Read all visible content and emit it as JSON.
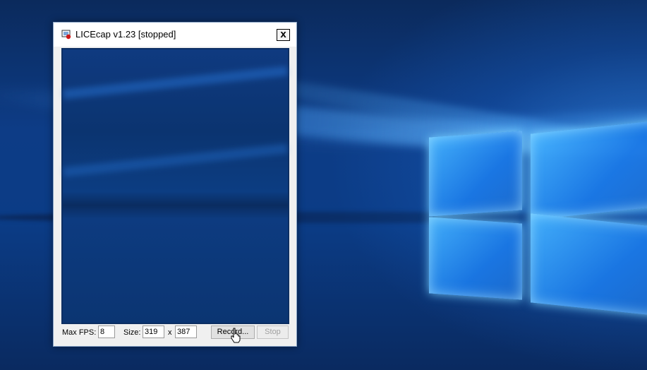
{
  "window": {
    "title": "LICEcap v1.23 [stopped]",
    "close_label": "x"
  },
  "controls": {
    "max_fps_label": "Max FPS:",
    "max_fps_value": "8",
    "size_label": "Size:",
    "width_value": "319",
    "x_label": "x",
    "height_value": "387",
    "record_label": "Record...",
    "stop_label": "Stop"
  },
  "icons": {
    "app": "licecap-app-icon",
    "cursor": "hand-pointer-cursor"
  },
  "colors": {
    "desktop_blue": "#0d3c86",
    "window_bg": "#f0f0f0",
    "disabled_text": "#a0a0a0"
  }
}
